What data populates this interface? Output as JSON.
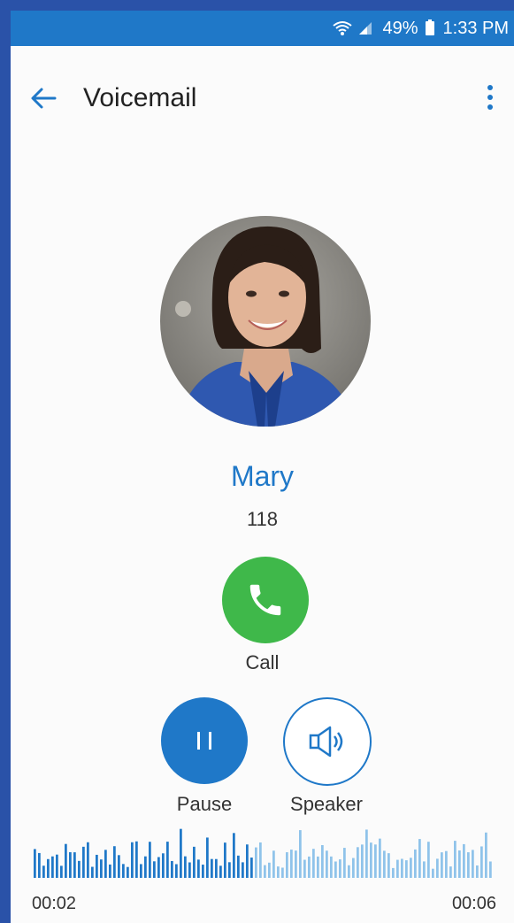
{
  "status_bar": {
    "battery": "49%",
    "time": "1:33 PM"
  },
  "appbar": {
    "title": "Voicemail"
  },
  "contact": {
    "name": "Mary",
    "number": "118"
  },
  "actions": {
    "call_label": "Call",
    "pause_label": "Pause",
    "speaker_label": "Speaker"
  },
  "playback": {
    "elapsed": "00:02",
    "duration": "00:06",
    "progress": 0.48
  },
  "colors": {
    "primary": "#1f78c8",
    "call_green": "#3fb84a",
    "frame": "#2a52a8"
  },
  "icons": [
    "back-arrow-icon",
    "more-vert-icon",
    "phone-icon",
    "pause-icon",
    "speaker-icon",
    "wifi-icon",
    "signal-icon",
    "battery-icon"
  ]
}
